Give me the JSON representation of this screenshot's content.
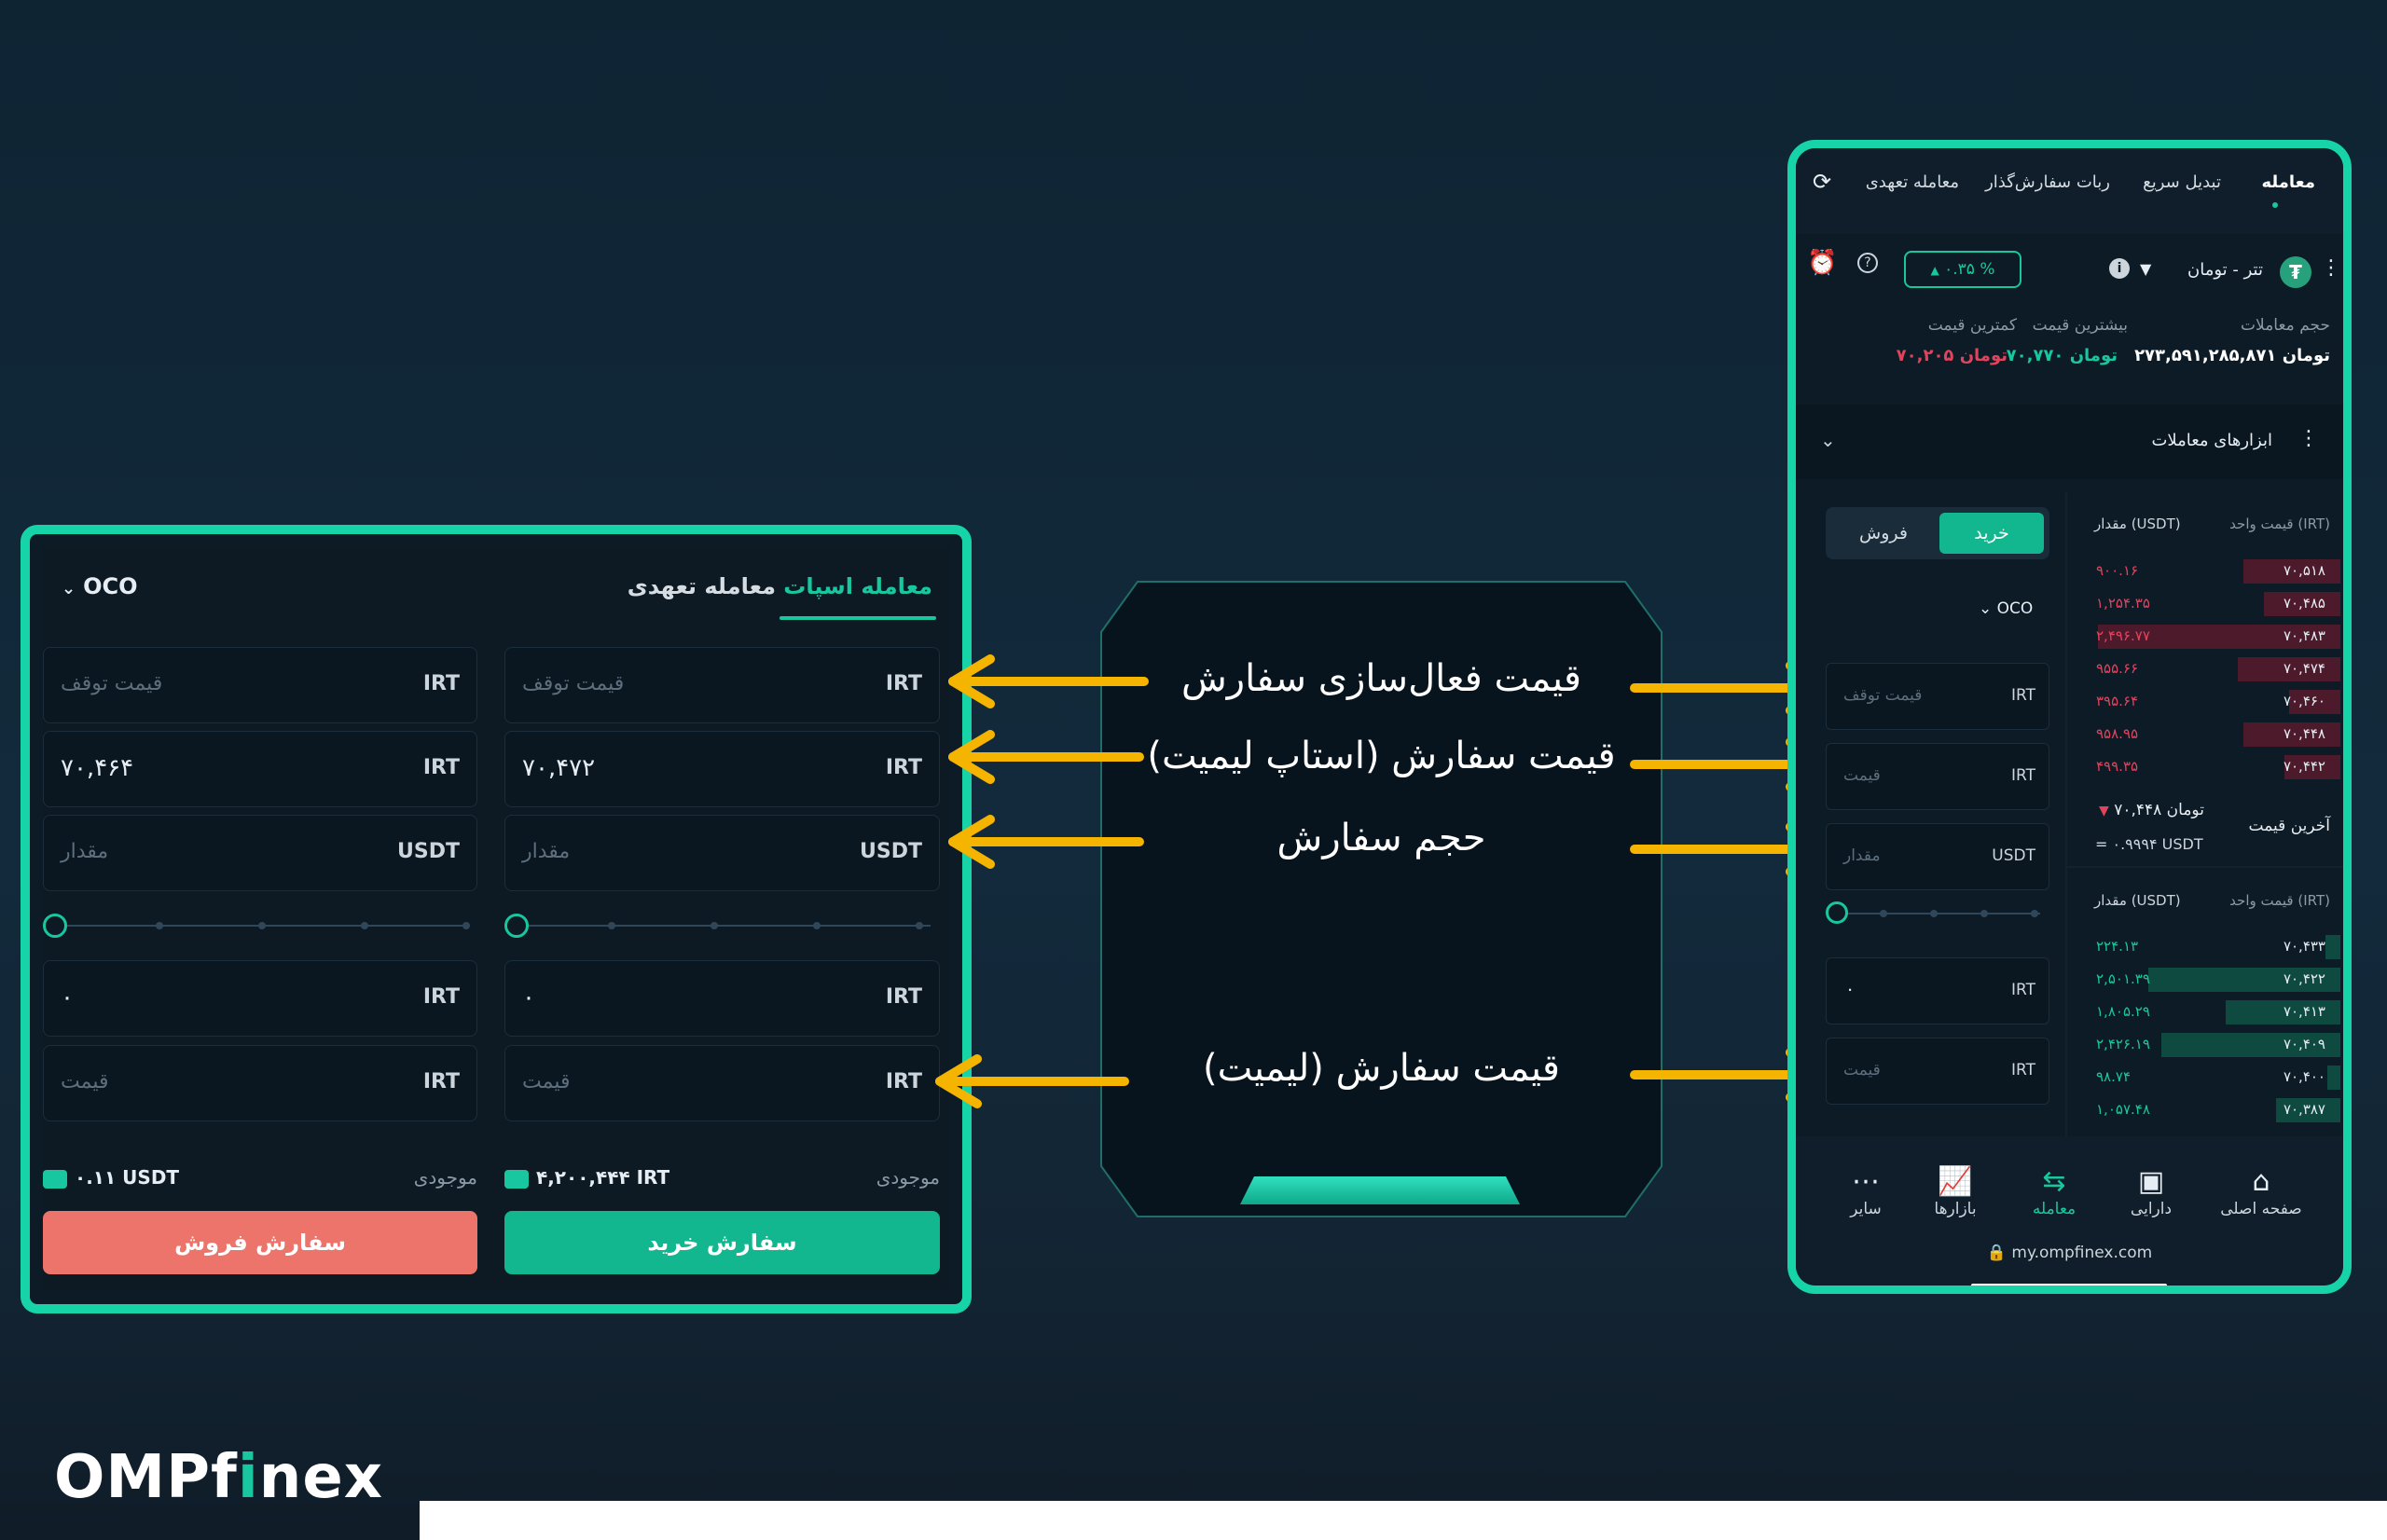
{
  "desktop": {
    "oco_label": "OCO",
    "tab_spot": "معامله اسپات",
    "tab_futures": "معامله تعهدی",
    "buy_col": {
      "stop_unit": "IRT",
      "stop_placeholder": "قیمت توقف",
      "limit_unit": "IRT",
      "limit_value": "۷۰,۴۷۲",
      "amount_unit": "USDT",
      "amount_placeholder": "مقدار",
      "total_unit": "IRT",
      "total_value": "۰",
      "price_unit": "IRT",
      "price_placeholder": "قیمت",
      "balance_label": "موجودی",
      "balance_value": "۴,۲۰۰,۴۴۴ IRT",
      "button": "سفارش خرید"
    },
    "sell_col": {
      "stop_unit": "IRT",
      "stop_placeholder": "قیمت توقف",
      "limit_unit": "IRT",
      "limit_value": "۷۰,۴۶۴",
      "amount_unit": "USDT",
      "amount_placeholder": "مقدار",
      "total_unit": "IRT",
      "total_value": "۰",
      "price_unit": "IRT",
      "price_placeholder": "قیمت",
      "balance_label": "موجودی",
      "balance_value": "۰.۱۱ USDT",
      "button": "سفارش فروش"
    }
  },
  "center": {
    "line1": "قیمت فعال‌سازی سفارش",
    "line2": "قیمت سفارش (استاپ لیمیت)",
    "line3": "حجم سفارش",
    "line4": "قیمت سفارش (لیمیت)"
  },
  "mobile": {
    "nav": {
      "trade": "معامله",
      "quick": "تبدیل سریع",
      "bot": "ربات سفارش‌گذار",
      "futures": "معامله تعهدی"
    },
    "pair": "تتر - تومان",
    "change_pct": "۰.۳۵ %",
    "stats": {
      "volume_label": "حجم معاملات",
      "volume_value": "۲۷۳,۵۹۱,۲۸۵,۸۷۱ تومان",
      "high_label": "بیشترین قیمت",
      "high_value": "۷۰,۷۷۰ تومان",
      "low_label": "کمترین قیمت",
      "low_value": "۷۰,۲۰۵ تومان"
    },
    "tools_label": "ابزارهای معاملات",
    "buy_label": "خرید",
    "sell_label": "فروش",
    "oco_label": "OCO",
    "fields": {
      "stop_unit": "IRT",
      "stop_placeholder": "قیمت توقف",
      "limit_unit": "IRT",
      "limit_placeholder": "قیمت",
      "amount_unit": "USDT",
      "amount_placeholder": "مقدار",
      "total_unit": "IRT",
      "total_value": "۰",
      "price_unit": "IRT",
      "price_placeholder": "قیمت"
    },
    "orderbook": {
      "price_header": "قیمت واحد (IRT)",
      "qty_header": "مقدار (USDT)",
      "asks": [
        {
          "price": "۷۰,۵۱۸",
          "qty": "۹۰۰.۱۶",
          "depth": 0.38
        },
        {
          "price": "۷۰,۴۸۵",
          "qty": "۱,۲۵۴.۳۵",
          "depth": 0.3
        },
        {
          "price": "۷۰,۴۸۳",
          "qty": "۲,۴۹۶.۷۷",
          "depth": 0.95
        },
        {
          "price": "۷۰,۴۷۴",
          "qty": "۹۵۵.۶۶",
          "depth": 0.4
        },
        {
          "price": "۷۰,۴۶۰",
          "qty": "۳۹۵.۶۴",
          "depth": 0.2
        },
        {
          "price": "۷۰,۴۴۸",
          "qty": "۹۵۸.۹۵",
          "depth": 0.38
        },
        {
          "price": "۷۰,۴۴۲",
          "qty": "۴۹۹.۳۵",
          "depth": 0.22
        }
      ],
      "last_label": "آخرین قیمت",
      "last_price": "۷۰,۴۴۸ تومان",
      "last_usdt": "= ۰.۹۹۹۴ USDT",
      "bids": [
        {
          "price": "۷۰,۴۳۳",
          "qty": "۲۲۴.۱۳",
          "depth": 0.06
        },
        {
          "price": "۷۰,۴۲۲",
          "qty": "۲,۵۰۱.۳۹",
          "depth": 0.75
        },
        {
          "price": "۷۰,۴۱۳",
          "qty": "۱,۸۰۵.۲۹",
          "depth": 0.45
        },
        {
          "price": "۷۰,۴۰۹",
          "qty": "۲,۴۲۶.۱۹",
          "depth": 0.7
        },
        {
          "price": "۷۰,۴۰۰",
          "qty": "۹۸.۷۴",
          "depth": 0.05
        },
        {
          "price": "۷۰,۳۸۷",
          "qty": "۱,۰۵۷.۴۸",
          "depth": 0.25
        }
      ]
    },
    "bottom_nav": {
      "home": "صفحه اصلی",
      "assets": "دارایی",
      "trade": "معامله",
      "markets": "بازارها",
      "more": "سایر"
    },
    "url": "my.ompfinex.com"
  },
  "logo": {
    "part1": "OMPf",
    "part2": "i",
    "part3": "nex"
  },
  "colors": {
    "accent": "#17d3a8",
    "arrow": "#f5b400",
    "sell": "#ec746b",
    "buy": "#13b78f"
  }
}
